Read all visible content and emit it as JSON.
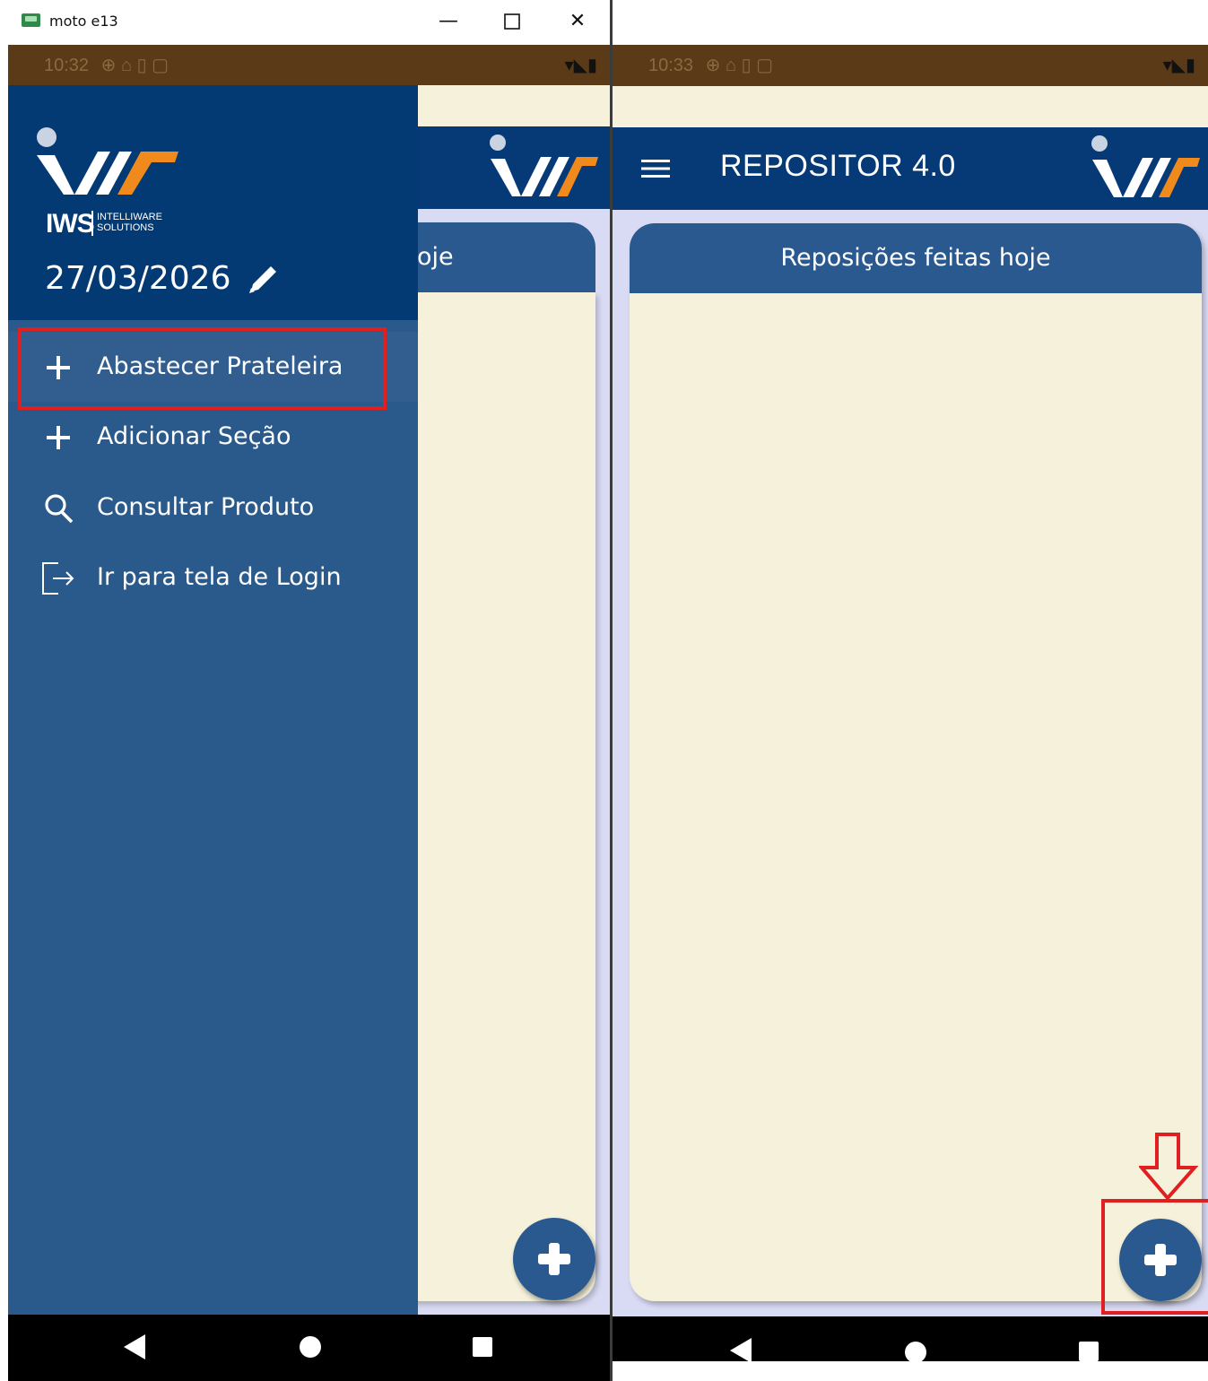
{
  "window": {
    "title": "moto e13",
    "minimize_label": "—",
    "close_label": "✕"
  },
  "left_phone": {
    "status_time": "10:32",
    "app_title_fragment": "oje",
    "drawer": {
      "logo_brand": "IWS",
      "logo_sub1": "INTELLIWARE",
      "logo_sub2": "SOLUTIONS",
      "date": "27/03/2026",
      "items": [
        {
          "label": "Abastecer Prateleira",
          "icon": "plus-icon",
          "highlighted": true
        },
        {
          "label": "Adicionar Seção",
          "icon": "plus-icon",
          "highlighted": false
        },
        {
          "label": "Consultar Produto",
          "icon": "search-icon",
          "highlighted": false
        },
        {
          "label": "Ir para tela de Login",
          "icon": "logout-icon",
          "highlighted": false
        }
      ]
    }
  },
  "right_phone": {
    "status_time": "10:33",
    "app_title": "REPOSITOR 4.0",
    "card_title": "Reposições feitas hoje"
  },
  "colors": {
    "appbar": "#053a76",
    "drawer": "#2a5a8c",
    "card_header": "#2a5990",
    "background_cream": "#f5f1da",
    "highlight_red": "#e02020",
    "logo_orange": "#f08a1c"
  }
}
